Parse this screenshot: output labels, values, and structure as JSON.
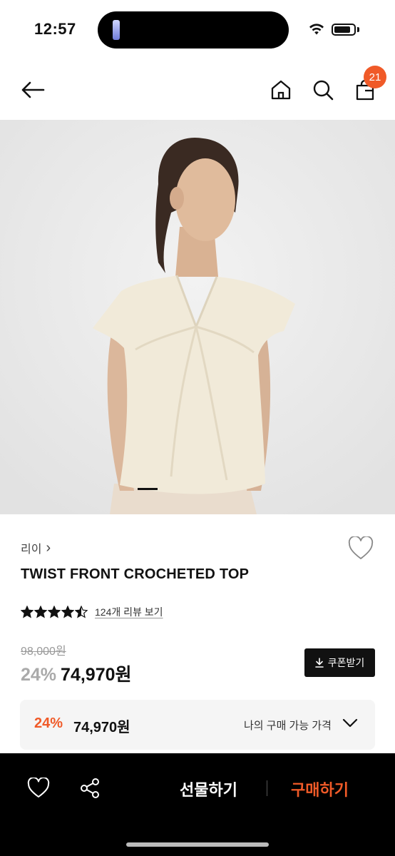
{
  "status_bar": {
    "time": "12:57"
  },
  "header": {
    "cart_count": "21"
  },
  "product": {
    "brand": "리이",
    "brand_chevron": "›",
    "title": "TWIST FRONT CROCHETED TOP",
    "rating": 4.5,
    "review_link": "124개 리뷰 보기",
    "original_price": "98,000원",
    "discount": "24%",
    "price": "74,970원",
    "coupon_label": "쿠폰받기"
  },
  "my_price": {
    "discount": "24%",
    "price": "74,970원",
    "label": "나의 구매 가능 가격"
  },
  "bottom_bar": {
    "gift_label": "선물하기",
    "buy_label": "구매하기"
  },
  "colors": {
    "accent": "#f05a28",
    "dark": "#111111",
    "panel": "#f5f5f5"
  },
  "icons": [
    "back-arrow-icon",
    "home-icon",
    "search-icon",
    "shopping-bag-icon",
    "heart-icon",
    "star-icon",
    "download-icon",
    "chevron-down-icon",
    "share-icon"
  ]
}
